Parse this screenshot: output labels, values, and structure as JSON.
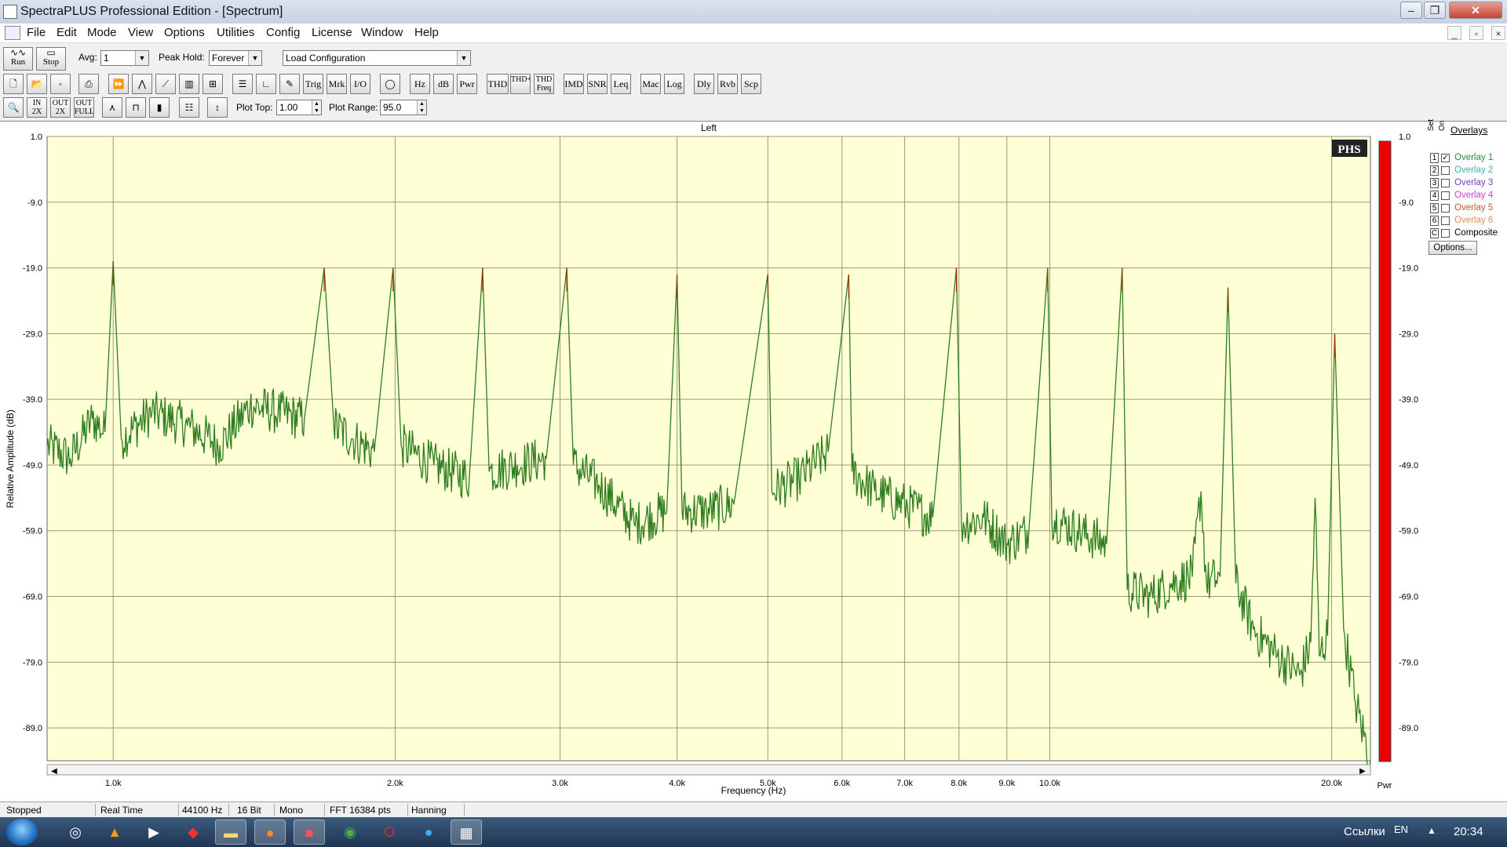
{
  "window": {
    "title": "SpectraPLUS Professional Edition - [Spectrum]"
  },
  "menu": {
    "items": [
      "File",
      "Edit",
      "Mode",
      "View",
      "Options",
      "Utilities",
      "Config",
      "License",
      "Window",
      "Help"
    ]
  },
  "toolbar1": {
    "run_label": "Run",
    "stop_label": "Stop",
    "avg_label": "Avg:",
    "avg_value": "1",
    "peak_hold_label": "Peak Hold:",
    "peak_hold_value": "Forever",
    "config_value": "Load Configuration"
  },
  "toolbar2": {
    "buttons": [
      "Trig",
      "Mrk",
      "I/O",
      "Hz",
      "dB",
      "Pwr",
      "THD",
      "THD+N",
      "THD Freq",
      "IMD",
      "SNR",
      "Leq",
      "Mac",
      "Log",
      "Dly",
      "Rvb",
      "Scp"
    ]
  },
  "toolbar3": {
    "zoom_buttons": [
      "IN 2X",
      "OUT 2X",
      "OUT FULL"
    ],
    "plot_top_label": "Plot Top:",
    "plot_top_value": "1.00",
    "plot_range_label": "Plot Range:",
    "plot_range_value": "95.0"
  },
  "plot": {
    "channel": "Left",
    "logo": "PHS",
    "meter_label": "Pwr",
    "bar_meter_color": "#ee0000",
    "plot_bg": "#ffffd6",
    "trace_color": "#2e7d1f",
    "peak_color": "#b02a00"
  },
  "overlays": {
    "title": "Overlays",
    "col_set": "Set",
    "col_on": "On",
    "items": [
      {
        "num": "1",
        "label": "Overlay 1",
        "checked": true,
        "color": "#2e8b3a"
      },
      {
        "num": "2",
        "label": "Overlay 2",
        "checked": false,
        "color": "#3fb0b0"
      },
      {
        "num": "3",
        "label": "Overlay 3",
        "checked": false,
        "color": "#7a3fbf"
      },
      {
        "num": "4",
        "label": "Overlay 4",
        "checked": false,
        "color": "#d040d0"
      },
      {
        "num": "5",
        "label": "Overlay 5",
        "checked": false,
        "color": "#c06020"
      },
      {
        "num": "6",
        "label": "Overlay 6",
        "checked": false,
        "color": "#e08a5a"
      },
      {
        "num": "C",
        "label": "Composite",
        "checked": false,
        "color": "#000000"
      }
    ],
    "options_label": "Options..."
  },
  "chart_data": {
    "type": "line",
    "title": "Left",
    "xlabel": "Frequency (Hz)",
    "ylabel": "Relative Amplitude (dB)",
    "x_scale": "log",
    "xlim": [
      850,
      22000
    ],
    "ylim": [
      -94,
      1
    ],
    "x_ticks": [
      {
        "v": 1000,
        "label": "1.0k"
      },
      {
        "v": 2000,
        "label": "2.0k"
      },
      {
        "v": 3000,
        "label": "3.0k"
      },
      {
        "v": 4000,
        "label": "4.0k"
      },
      {
        "v": 5000,
        "label": "5.0k"
      },
      {
        "v": 6000,
        "label": "6.0k"
      },
      {
        "v": 7000,
        "label": "7.0k"
      },
      {
        "v": 8000,
        "label": "8.0k"
      },
      {
        "v": 9000,
        "label": "9.0k"
      },
      {
        "v": 10000,
        "label": "10.0k"
      },
      {
        "v": 20000,
        "label": "20.0k"
      }
    ],
    "y_ticks": [
      1.0,
      -9.0,
      -19.0,
      -29.0,
      -39.0,
      -49.0,
      -59.0,
      -69.0,
      -79.0,
      -89.0
    ],
    "y_tick_labels": [
      "1.0",
      "-9.0",
      "-19.0",
      "-29.0",
      "-39.0",
      "-49.0",
      "-59.0",
      "-69.0",
      "-79.0",
      "-89.0"
    ],
    "grid": true,
    "series": [
      {
        "points": [
          [
            850,
            -46
          ],
          [
            900,
            -48
          ],
          [
            950,
            -42
          ],
          [
            980,
            -44
          ],
          [
            1000,
            -18
          ],
          [
            1020,
            -45
          ],
          [
            1100,
            -41
          ],
          [
            1200,
            -43
          ],
          [
            1300,
            -46
          ],
          [
            1400,
            -40
          ],
          [
            1500,
            -41
          ],
          [
            1600,
            -42
          ],
          [
            1680,
            -19
          ],
          [
            1720,
            -43
          ],
          [
            1800,
            -45
          ],
          [
            1900,
            -47
          ],
          [
            1990,
            -19
          ],
          [
            2030,
            -46
          ],
          [
            2200,
            -49
          ],
          [
            2400,
            -51
          ],
          [
            2480,
            -19
          ],
          [
            2520,
            -50
          ],
          [
            2700,
            -49
          ],
          [
            2900,
            -48
          ],
          [
            3050,
            -19
          ],
          [
            3100,
            -49
          ],
          [
            3300,
            -52
          ],
          [
            3600,
            -58
          ],
          [
            3900,
            -56
          ],
          [
            4000,
            -20
          ],
          [
            4050,
            -56
          ],
          [
            4300,
            -56
          ],
          [
            4600,
            -55
          ],
          [
            5000,
            -20
          ],
          [
            5050,
            -53
          ],
          [
            5400,
            -51
          ],
          [
            5800,
            -47
          ],
          [
            6100,
            -20
          ],
          [
            6150,
            -50
          ],
          [
            6500,
            -53
          ],
          [
            7000,
            -55
          ],
          [
            7500,
            -57
          ],
          [
            7950,
            -19
          ],
          [
            8050,
            -58
          ],
          [
            8500,
            -57
          ],
          [
            9000,
            -61
          ],
          [
            9500,
            -59
          ],
          [
            9950,
            -19
          ],
          [
            10050,
            -57
          ],
          [
            10700,
            -59
          ],
          [
            11500,
            -61
          ],
          [
            11950,
            -19
          ],
          [
            12100,
            -68
          ],
          [
            12800,
            -69
          ],
          [
            13500,
            -67
          ],
          [
            14200,
            -66
          ],
          [
            14500,
            -53
          ],
          [
            14700,
            -67
          ],
          [
            15200,
            -66
          ],
          [
            15500,
            -22
          ],
          [
            15800,
            -67
          ],
          [
            16500,
            -74
          ],
          [
            17500,
            -78
          ],
          [
            18500,
            -81
          ],
          [
            19000,
            -76
          ],
          [
            19200,
            -54
          ],
          [
            19400,
            -78
          ],
          [
            19800,
            -75
          ],
          [
            20150,
            -29
          ],
          [
            20600,
            -74
          ],
          [
            21200,
            -85
          ],
          [
            22000,
            -94
          ]
        ]
      }
    ]
  },
  "statusbar": {
    "fields": [
      "Stopped",
      "Real Time",
      "44100 Hz",
      "16 Bit",
      "Mono",
      "FFT 16384 pts",
      "Hanning"
    ]
  },
  "taskbar": {
    "language": "EN",
    "tray_text": "Ссылки",
    "clock": "20:34"
  }
}
